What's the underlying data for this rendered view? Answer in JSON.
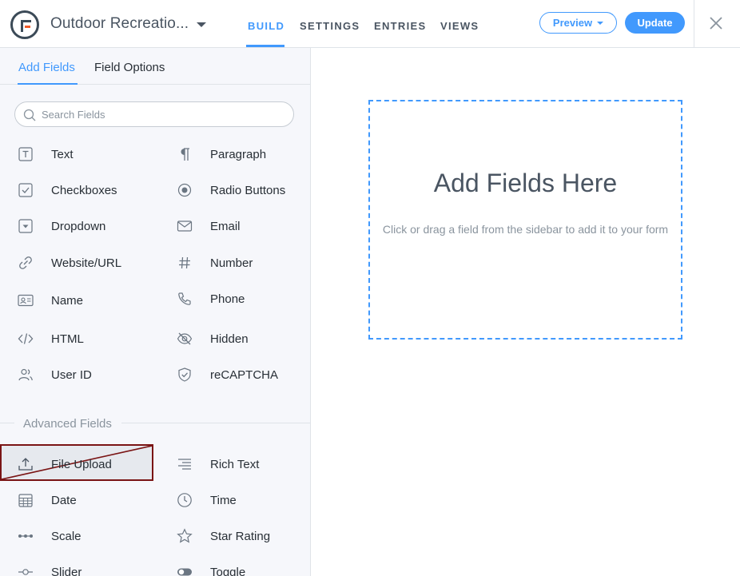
{
  "header": {
    "form_title": "Outdoor Recreatio...",
    "tabs": [
      {
        "label": "BUILD",
        "active": true
      },
      {
        "label": "SETTINGS",
        "active": false
      },
      {
        "label": "ENTRIES",
        "active": false
      },
      {
        "label": "VIEWS",
        "active": false
      }
    ],
    "preview_label": "Preview",
    "update_label": "Update",
    "accent": "#4199fd"
  },
  "sidebar": {
    "tabs": [
      {
        "label": "Add Fields",
        "active": true
      },
      {
        "label": "Field Options",
        "active": false
      }
    ],
    "search_placeholder": "Search Fields",
    "fields": [
      {
        "label": "Text",
        "icon": "text-icon"
      },
      {
        "label": "Paragraph",
        "icon": "paragraph-icon"
      },
      {
        "label": "Checkboxes",
        "icon": "checkbox-icon"
      },
      {
        "label": "Radio Buttons",
        "icon": "radio-icon"
      },
      {
        "label": "Dropdown",
        "icon": "dropdown-icon"
      },
      {
        "label": "Email",
        "icon": "email-icon"
      },
      {
        "label": "Website/URL",
        "icon": "link-icon"
      },
      {
        "label": "Number",
        "icon": "hash-icon"
      },
      {
        "label": "Name",
        "icon": "id-card-icon"
      },
      {
        "label": "Phone",
        "icon": "phone-icon"
      },
      {
        "label": "HTML",
        "icon": "code-icon"
      },
      {
        "label": "Hidden",
        "icon": "eye-off-icon"
      },
      {
        "label": "User ID",
        "icon": "users-icon"
      },
      {
        "label": "reCAPTCHA",
        "icon": "shield-icon"
      }
    ],
    "advanced_label": "Advanced Fields",
    "advanced_fields": [
      {
        "label": "File Upload",
        "icon": "upload-icon",
        "highlighted": true
      },
      {
        "label": "Rich Text",
        "icon": "align-right-icon"
      },
      {
        "label": "Date",
        "icon": "calendar-icon"
      },
      {
        "label": "Time",
        "icon": "clock-icon"
      },
      {
        "label": "Scale",
        "icon": "scale-icon"
      },
      {
        "label": "Star Rating",
        "icon": "star-icon"
      },
      {
        "label": "Slider",
        "icon": "slider-icon"
      },
      {
        "label": "Toggle",
        "icon": "toggle-icon"
      }
    ]
  },
  "canvas": {
    "title": "Add Fields Here",
    "subtitle": "Click or drag a field from the sidebar to add it to your form"
  }
}
